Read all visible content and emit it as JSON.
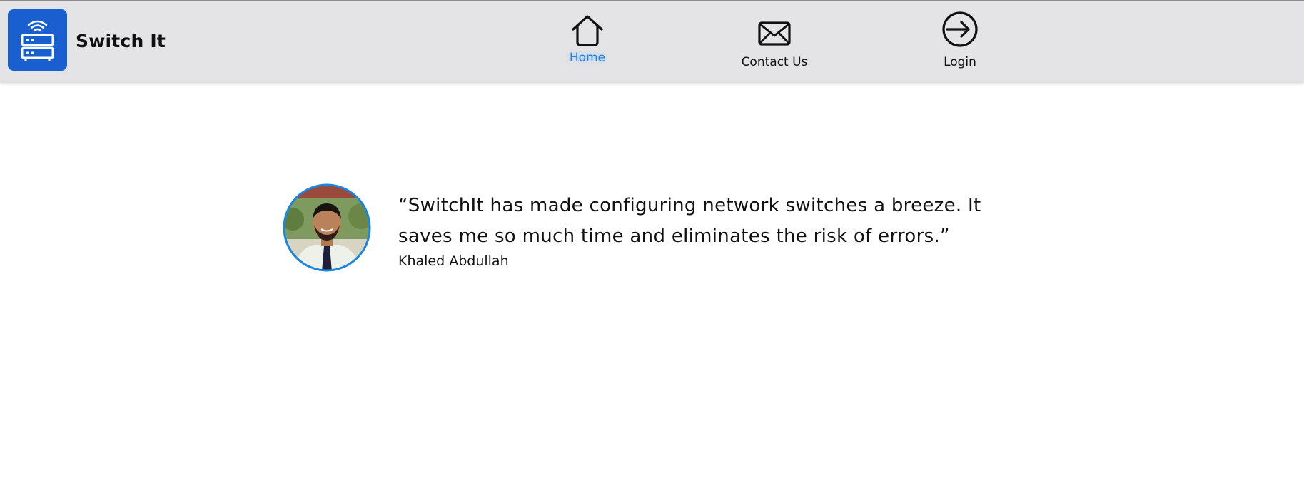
{
  "brand": {
    "name": "Switch It",
    "logo_icon": "network-switch-icon",
    "logo_bg_color": "#1a5fcf"
  },
  "nav": {
    "accent_color": "#1a86e0",
    "items": [
      {
        "label": "Home",
        "icon": "home-icon",
        "active": true
      },
      {
        "label": "Contact Us",
        "icon": "envelope-icon",
        "active": false
      },
      {
        "label": "Login",
        "icon": "login-icon",
        "active": false
      }
    ]
  },
  "testimonial": {
    "quote": "“SwitchIt has made configuring network switches a breeze. It saves me so much time and eliminates the risk of errors.”",
    "author": "Khaled Abdullah",
    "avatar_border_color": "#1a86e0"
  }
}
